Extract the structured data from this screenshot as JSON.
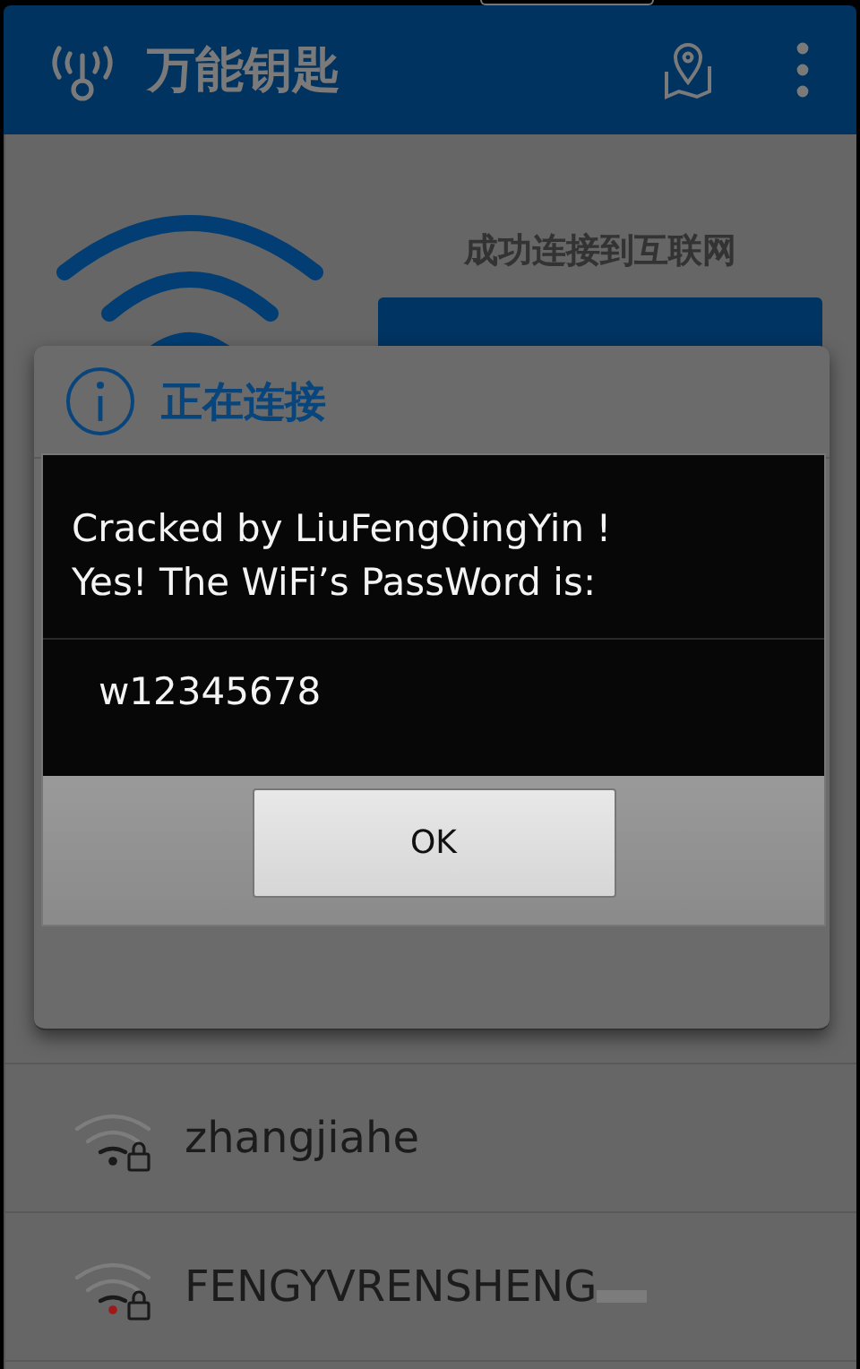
{
  "app_bar": {
    "title": "万能钥匙"
  },
  "status": {
    "message": "成功连接到互联网"
  },
  "connecting_dialog": {
    "title": "正在连接"
  },
  "alert": {
    "message_lines": [
      "Cracked by LiuFengQingYin !",
      "Yes! The WiFi’s PassWord is:"
    ],
    "password": "w12345678",
    "button": "OK"
  },
  "networks": [
    {
      "name": "zhangjiahe",
      "color": "#1a1a1a"
    },
    {
      "name": "FENGYVRENSHENG",
      "color": "#a01818"
    }
  ]
}
